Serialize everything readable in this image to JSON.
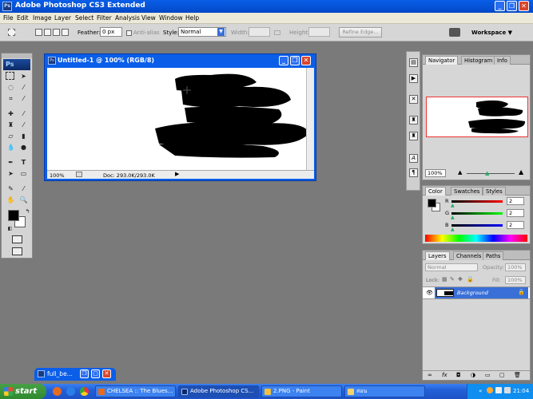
{
  "app": {
    "title": "Adobe Photoshop CS3 Extended",
    "logo": "Ps"
  },
  "menu": [
    "File",
    "Edit",
    "Image",
    "Layer",
    "Select",
    "Filter",
    "Analysis",
    "View",
    "Window",
    "Help"
  ],
  "options": {
    "feather_label": "Feather:",
    "feather_value": "0 px",
    "antialias_label": "Anti-alias",
    "style_label": "Style:",
    "style_value": "Normal",
    "width_label": "Width:",
    "height_label": "Height:",
    "refine_label": "Refine Edge...",
    "workspace_label": "Workspace"
  },
  "document": {
    "title": "Untitled-1 @ 100% (RGB/8)",
    "zoom": "100%",
    "doc_info": "Doc: 293.0K/293.0K"
  },
  "navigator": {
    "tabs": [
      "Navigator",
      "Histogram",
      "Info"
    ],
    "zoom": "100%"
  },
  "color": {
    "tabs": [
      "Color",
      "Swatches",
      "Styles"
    ],
    "channels": [
      {
        "label": "R",
        "value": "2",
        "color": "#d40000"
      },
      {
        "label": "G",
        "value": "2",
        "color": "#00a000"
      },
      {
        "label": "B",
        "value": "2",
        "color": "#0000c0"
      }
    ]
  },
  "layers": {
    "tabs": [
      "Layers",
      "Channels",
      "Paths"
    ],
    "blend": "Normal",
    "opacity_label": "Opacity:",
    "opacity_value": "100%",
    "lock_label": "Lock:",
    "fill_label": "Fill:",
    "fill_value": "100%",
    "items": [
      {
        "name": "Background"
      }
    ]
  },
  "minimized": {
    "title": "full_be..."
  },
  "taskbar": {
    "start": "start",
    "tasks": [
      "CHELSEA :: The Blues...",
      "Adobe Photoshop CS...",
      "2.PNG - Paint",
      "สอน"
    ],
    "lang": "EN",
    "clock": "21:04"
  }
}
